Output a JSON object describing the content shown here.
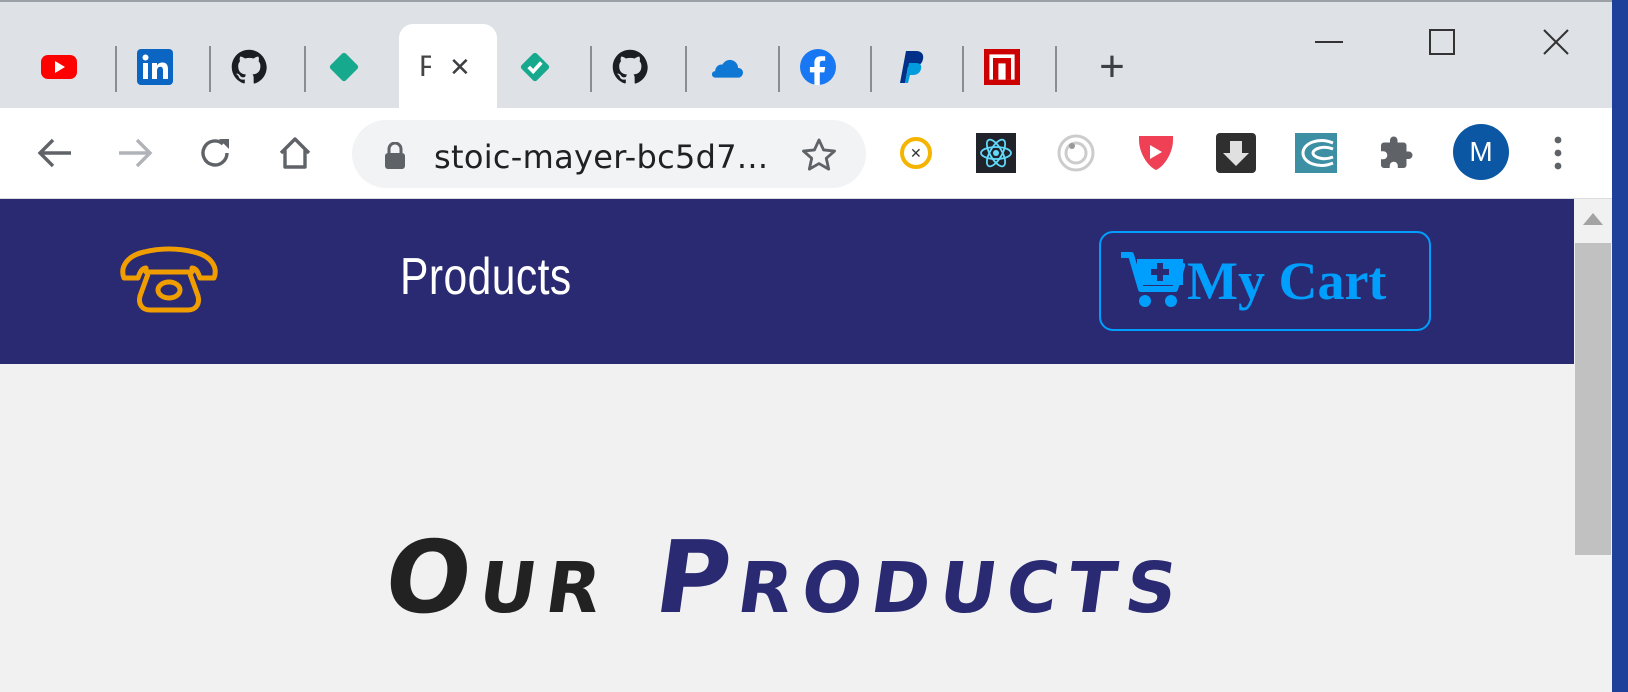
{
  "browser": {
    "tabs": [
      {
        "icon": "youtube-icon"
      },
      {
        "icon": "linkedin-icon"
      },
      {
        "icon": "github-icon"
      },
      {
        "icon": "teal-diamond-icon"
      },
      {
        "icon": "page-icon",
        "title": "P",
        "active": true,
        "close": "✕"
      },
      {
        "icon": "check-diamond-icon"
      },
      {
        "icon": "github-icon"
      },
      {
        "icon": "onedrive-icon"
      },
      {
        "icon": "facebook-icon"
      },
      {
        "icon": "paypal-icon"
      },
      {
        "icon": "netlify-n-icon"
      }
    ],
    "new_tab": "+",
    "url": "stoic-mayer-bc5d7...",
    "profile_initial": "M",
    "extensions": [
      "axe-icon",
      "react-devtools-icon",
      "circle-target-icon",
      "pocket-icon",
      "download-icon",
      "wave-icon",
      "puzzle-icon"
    ]
  },
  "page": {
    "nav": {
      "products_link": "Products",
      "cart_label": "My Cart",
      "phone_icon": "phone-icon",
      "cart_icon": "cart-plus-icon"
    },
    "heading_part1": "Our",
    "heading_part2": "Products"
  },
  "colors": {
    "navbar": "#2a2a72",
    "accent_orange": "#f09d00",
    "accent_blue": "#009ffd",
    "page_bg": "#f1f1f2"
  }
}
